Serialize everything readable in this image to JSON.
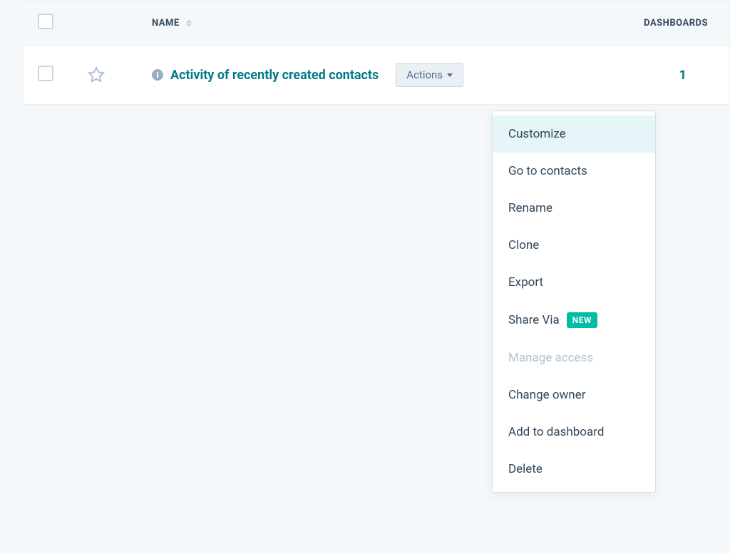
{
  "table": {
    "columns": {
      "name": "NAME",
      "dashboards": "DASHBOARDS"
    },
    "row": {
      "report_name": "Activity of recently created contacts",
      "actions_label": "Actions",
      "dashboards_count": "1"
    }
  },
  "dropdown": {
    "customize": "Customize",
    "go_to_contacts": "Go to contacts",
    "rename": "Rename",
    "clone": "Clone",
    "export": "Export",
    "share_via": "Share Via",
    "share_via_badge": "NEW",
    "manage_access": "Manage access",
    "change_owner": "Change owner",
    "add_to_dashboard": "Add to dashboard",
    "delete": "Delete"
  }
}
